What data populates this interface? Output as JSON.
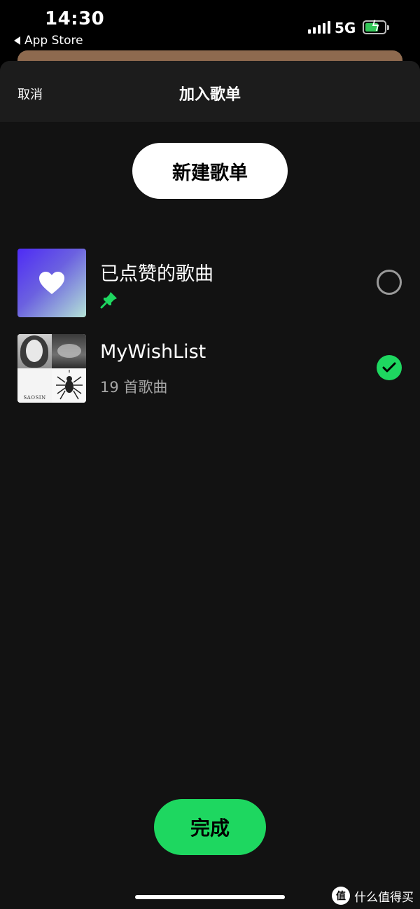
{
  "status_bar": {
    "time": "14:30",
    "back_app": "App Store",
    "network": "5G"
  },
  "sheet": {
    "cancel_label": "取消",
    "title": "加入歌单",
    "new_playlist_label": "新建歌单"
  },
  "playlists": [
    {
      "title": "已点赞的歌曲",
      "pinned": true,
      "selected": false
    },
    {
      "title": "MyWishList",
      "subtitle": "19 首歌曲",
      "selected": true,
      "cover_text": "SAOSIN"
    }
  ],
  "done_label": "完成",
  "watermark": {
    "logo": "值",
    "text": "什么值得买"
  },
  "colors": {
    "accent": "#1ed760",
    "sheet_bg": "#121212",
    "header_bg": "#1c1c1c"
  }
}
